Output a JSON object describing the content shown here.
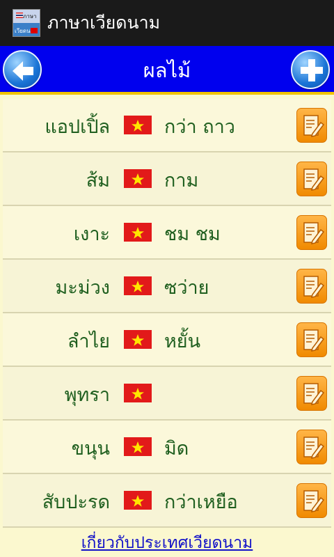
{
  "app": {
    "title": "ภาษาเวียดนาม",
    "icon_top_text": "ภาษา",
    "icon_bottom_text": "เวียดนาม"
  },
  "header": {
    "title": "ผลไม้",
    "back_icon": "arrow-left-icon",
    "add_icon": "plus-icon"
  },
  "items": [
    {
      "thai": "แอปเปิ้ล",
      "viet": "กว่า ถาว"
    },
    {
      "thai": "ส้ม",
      "viet": "กาม"
    },
    {
      "thai": "เงาะ",
      "viet": "ชม ชม"
    },
    {
      "thai": "มะม่วง",
      "viet": "ซว่าย"
    },
    {
      "thai": "ลำไย",
      "viet": "หยั้น"
    },
    {
      "thai": "พุทรา",
      "viet": ""
    },
    {
      "thai": "ขนุน",
      "viet": "มิด"
    },
    {
      "thai": "สับปะรด",
      "viet": "กว่าเหยือ"
    }
  ],
  "footer": {
    "link": "เกี่ยวกับประเทศเวียดนาม"
  },
  "colors": {
    "header_bg": "#0000ee",
    "accent_line": "#f2c400",
    "text_green": "#1f5f1f",
    "edit_orange": "#f08a00",
    "list_bg": "#fbf8cf"
  }
}
